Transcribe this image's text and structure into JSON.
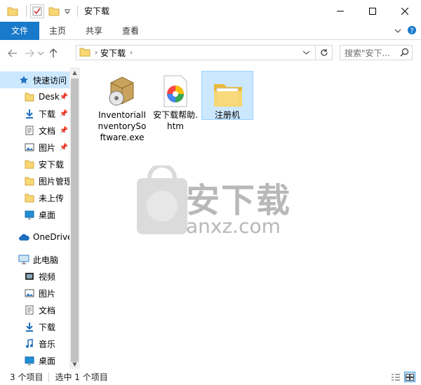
{
  "window": {
    "title": "安下载",
    "controls": [
      "minimize",
      "maximize",
      "close"
    ]
  },
  "ribbon": {
    "tabs": [
      "文件",
      "主页",
      "共享",
      "查看"
    ]
  },
  "address": {
    "crumb": "安下载",
    "search_placeholder": "搜索\"安下..."
  },
  "navpane": {
    "items": [
      {
        "label": "快速访问",
        "icon": "star-icon"
      },
      {
        "label": "Desk",
        "icon": "folder-icon",
        "pinned": true
      },
      {
        "label": "下载",
        "icon": "download-arrow-icon",
        "pinned": true
      },
      {
        "label": "文档",
        "icon": "document-icon",
        "pinned": true
      },
      {
        "label": "图片",
        "icon": "picture-icon",
        "pinned": true
      },
      {
        "label": "安下载",
        "icon": "folder-icon"
      },
      {
        "label": "图片管理",
        "icon": "folder-icon"
      },
      {
        "label": "未上传",
        "icon": "folder-icon"
      },
      {
        "label": "桌面",
        "icon": "desktop-icon"
      },
      {
        "label": "OneDrive",
        "icon": "cloud-icon"
      },
      {
        "label": "此电脑",
        "icon": "computer-icon"
      },
      {
        "label": "视频",
        "icon": "video-icon"
      },
      {
        "label": "图片",
        "icon": "picture-icon"
      },
      {
        "label": "文档",
        "icon": "document-icon"
      },
      {
        "label": "下载",
        "icon": "download-arrow-icon"
      },
      {
        "label": "音乐",
        "icon": "music-note-icon"
      },
      {
        "label": "桌面",
        "icon": "desktop-icon"
      }
    ]
  },
  "files": [
    {
      "name": "InventorialInventorySoftware.exe",
      "icon": "installer-box-icon",
      "selected": false
    },
    {
      "name": "安下载帮助.htm",
      "icon": "colorful-browser-icon",
      "selected": false
    },
    {
      "name": "注册机",
      "icon": "folder-icon",
      "selected": true
    }
  ],
  "watermark": {
    "title": "安下载",
    "sub": "anxz.com"
  },
  "status": {
    "count": "3 个项目",
    "selected": "选中 1 个项目"
  },
  "colors": {
    "accent": "#1979ca",
    "selection": "#cce8ff",
    "folder": "#f8d775"
  }
}
